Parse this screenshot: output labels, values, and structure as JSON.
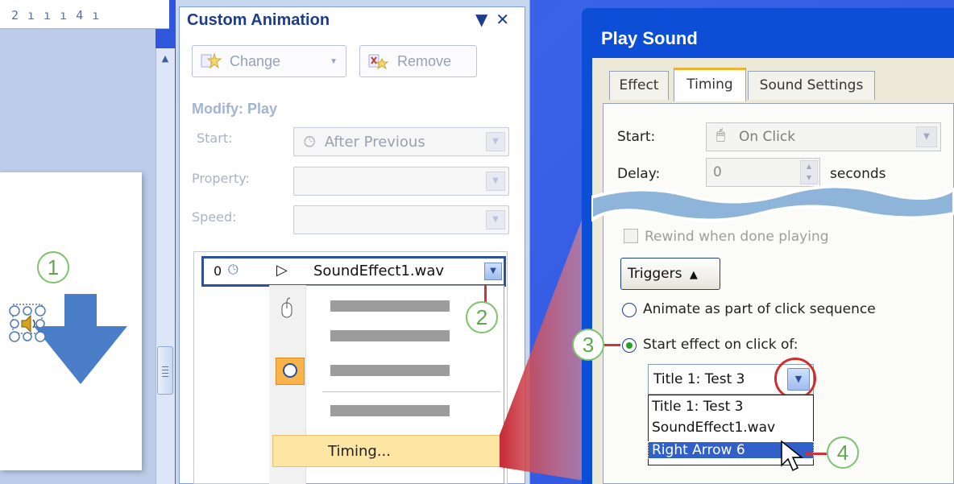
{
  "ruler": {
    "text": "2 ı ı ı 4 ı"
  },
  "callouts": [
    "1",
    "2",
    "3",
    "4"
  ],
  "pane": {
    "title": "Custom Animation",
    "controls": [
      "▼",
      "✕"
    ],
    "change_label": "Change",
    "remove_label": "Remove",
    "modify_label": "Modify: Play",
    "start_label": "Start:",
    "start_value": "After Previous",
    "property_label": "Property:",
    "speed_label": "Speed:",
    "list_item": {
      "index": "0",
      "name": "SoundEffect1.wav"
    },
    "menu_timing": "Timing..."
  },
  "dialog": {
    "title": "Play Sound",
    "tabs": [
      "Effect",
      "Timing",
      "Sound Settings"
    ],
    "start_label": "Start:",
    "start_value": "On Click",
    "delay_label": "Delay:",
    "delay_value": "0",
    "seconds_label": "seconds",
    "rewind_label": "Rewind when done playing",
    "triggers_label": "Triggers",
    "radio_animate": "Animate as part of click sequence",
    "radio_start": "Start effect on click of:",
    "trigger_value": "Title 1: Test 3",
    "dropdown_options": [
      "Title 1: Test 3",
      "SoundEffect1.wav",
      "Right Arrow 6"
    ]
  },
  "colors": {
    "accent_red": "#d22d2d",
    "callout_green": "#7cc36b",
    "xp_title_blue": "#0c4ed6"
  }
}
